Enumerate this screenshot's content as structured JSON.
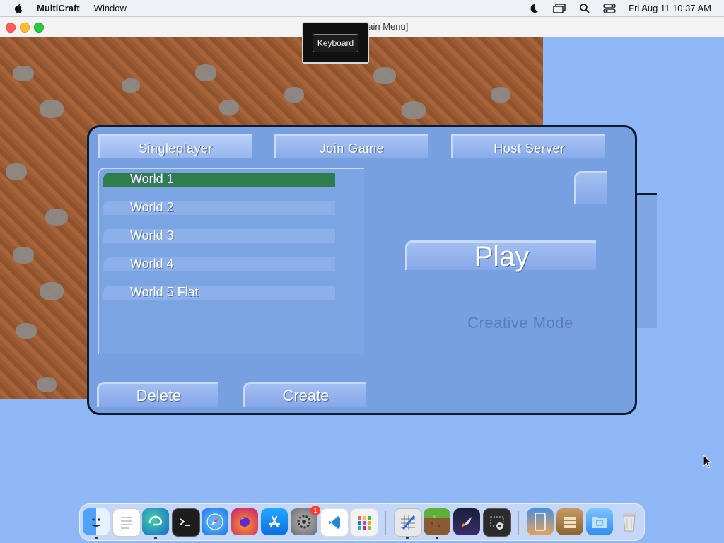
{
  "menubar": {
    "app_name": "MultiCraft",
    "menus": [
      "Window"
    ],
    "clock": "Fri Aug 11  10:37 AM"
  },
  "window": {
    "title": "MultiCraft [Main Menu]",
    "keyboard_button": "Keyboard"
  },
  "tabs": [
    {
      "label": "Singleplayer",
      "active": true
    },
    {
      "label": "Join Game",
      "active": false
    },
    {
      "label": "Host Server",
      "active": false
    }
  ],
  "worlds": [
    {
      "name": "World 1",
      "selected": true
    },
    {
      "name": "World 2",
      "selected": false
    },
    {
      "name": "World 3",
      "selected": false
    },
    {
      "name": "World 4",
      "selected": false
    },
    {
      "name": "World 5 Flat",
      "selected": false
    }
  ],
  "buttons": {
    "play": "Play",
    "delete": "Delete",
    "create": "Create"
  },
  "mode_label": "Creative Mode",
  "dock": {
    "settings_badge": "1",
    "apps": [
      "finder-icon",
      "textedit-icon",
      "edge-icon",
      "terminal-icon",
      "safari-icon",
      "firefox-icon",
      "app-store-icon",
      "system-settings-icon",
      "vscode-icon",
      "launchpad-icon",
      "grid-tool-icon",
      "multicraft-icon",
      "rocket-icon",
      "screenshot-icon",
      "preview-icon",
      "archive-icon",
      "folder-icon",
      "trash-icon"
    ]
  },
  "colors": {
    "panel": "#76a0e0",
    "selected_world": "#2e7d4a",
    "sky": "#8fb6f5",
    "dirt": "#9a5a33"
  }
}
